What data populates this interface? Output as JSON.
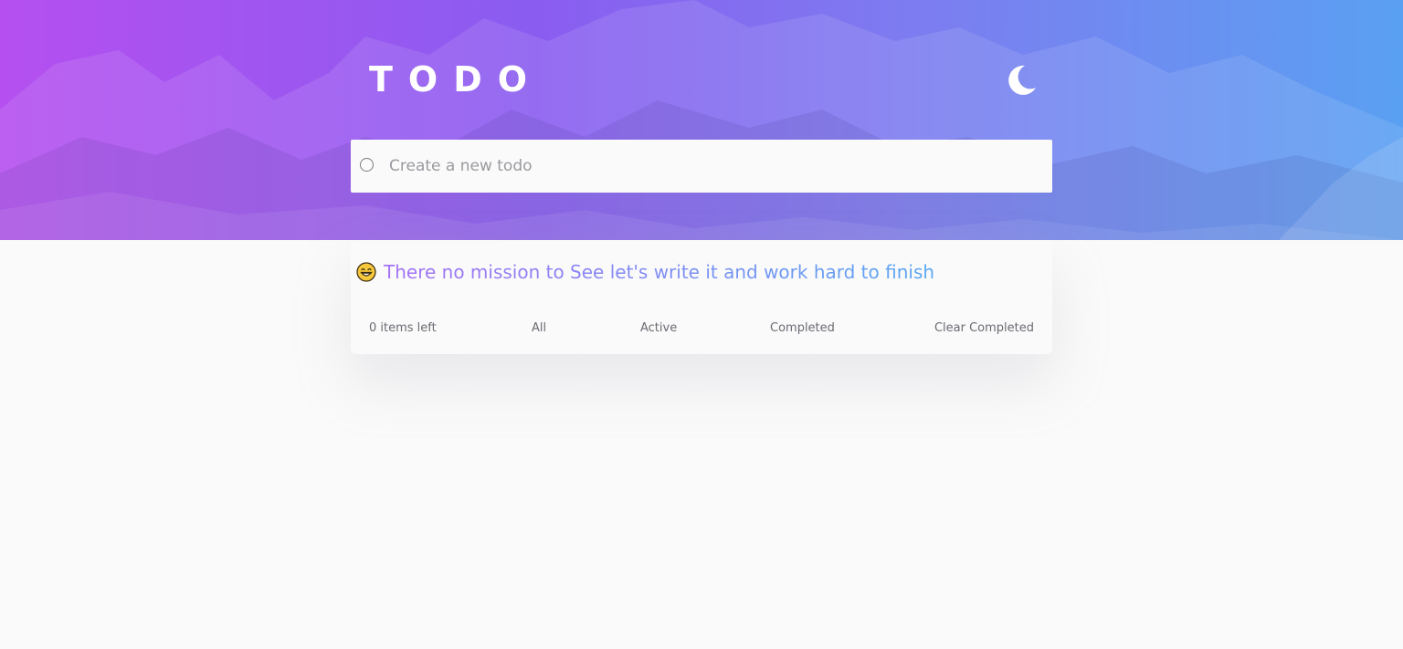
{
  "header": {
    "title": "TODO",
    "theme_toggle_icon": "moon-icon"
  },
  "new_todo": {
    "placeholder": "Create a new todo",
    "value": ""
  },
  "empty_state": {
    "icon": "grinning-face-icon",
    "message": "There no mission to See let's write it and work hard to finish"
  },
  "footer": {
    "items_left": "0 items left",
    "filters": {
      "all": "All",
      "active": "Active",
      "completed": "Completed"
    },
    "clear_completed": "Clear Completed"
  },
  "colors": {
    "gradient_start": "#b54ff0",
    "gradient_end": "#5aa0f2",
    "background": "#fafafa"
  }
}
